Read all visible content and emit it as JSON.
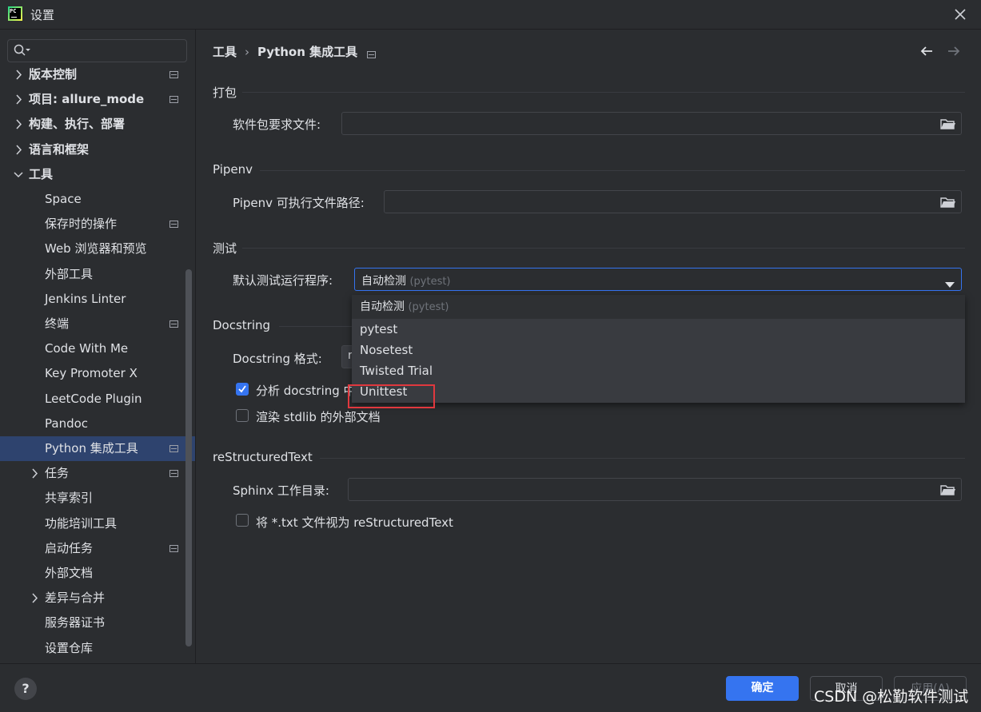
{
  "window": {
    "title": "设置",
    "logo_text": "PC"
  },
  "search": {
    "placeholder": ""
  },
  "sidebar": {
    "items": [
      {
        "label": "版本控制",
        "level": 0,
        "expand": "collapsed",
        "modified": true
      },
      {
        "label": "项目: allure_mode",
        "level": 0,
        "expand": "collapsed",
        "modified": true
      },
      {
        "label": "构建、执行、部署",
        "level": 0,
        "expand": "collapsed",
        "modified": false
      },
      {
        "label": "语言和框架",
        "level": 0,
        "expand": "collapsed",
        "modified": false
      },
      {
        "label": "工具",
        "level": 0,
        "expand": "expanded",
        "modified": false
      },
      {
        "label": "Space",
        "level": 1,
        "expand": "none",
        "modified": false
      },
      {
        "label": "保存时的操作",
        "level": 1,
        "expand": "none",
        "modified": true
      },
      {
        "label": "Web 浏览器和预览",
        "level": 1,
        "expand": "none",
        "modified": false
      },
      {
        "label": "外部工具",
        "level": 1,
        "expand": "none",
        "modified": false
      },
      {
        "label": "Jenkins Linter",
        "level": 1,
        "expand": "none",
        "modified": false
      },
      {
        "label": "终端",
        "level": 1,
        "expand": "none",
        "modified": true
      },
      {
        "label": "Code With Me",
        "level": 1,
        "expand": "none",
        "modified": false
      },
      {
        "label": "Key Promoter X",
        "level": 1,
        "expand": "none",
        "modified": false
      },
      {
        "label": "LeetCode Plugin",
        "level": 1,
        "expand": "none",
        "modified": false
      },
      {
        "label": "Pandoc",
        "level": 1,
        "expand": "none",
        "modified": false
      },
      {
        "label": "Python 集成工具",
        "level": 1,
        "expand": "none",
        "modified": true,
        "selected": true
      },
      {
        "label": "任务",
        "level": 1,
        "expand": "collapsed",
        "modified": true
      },
      {
        "label": "共享索引",
        "level": 1,
        "expand": "none",
        "modified": false
      },
      {
        "label": "功能培训工具",
        "level": 1,
        "expand": "none",
        "modified": false
      },
      {
        "label": "启动任务",
        "level": 1,
        "expand": "none",
        "modified": true
      },
      {
        "label": "外部文档",
        "level": 1,
        "expand": "none",
        "modified": false
      },
      {
        "label": "差异与合并",
        "level": 1,
        "expand": "collapsed",
        "modified": false
      },
      {
        "label": "服务器证书",
        "level": 1,
        "expand": "none",
        "modified": false
      },
      {
        "label": "设置仓库",
        "level": 1,
        "expand": "none",
        "modified": false
      }
    ]
  },
  "breadcrumb": {
    "parent": "工具",
    "separator": "›",
    "current": "Python 集成工具"
  },
  "sections": {
    "packaging": {
      "title": "打包",
      "requirements_label": "软件包要求文件:",
      "requirements_value": ""
    },
    "pipenv": {
      "title": "Pipenv",
      "path_label": "Pipenv 可执行文件路径:",
      "path_value": ""
    },
    "testing": {
      "title": "测试",
      "runner_label": "默认测试运行程序:",
      "runner_value": "自动检测",
      "runner_hint": "(pytest)"
    },
    "docstring": {
      "title": "Docstring",
      "format_label": "Docstring 格式:",
      "format_value": "r",
      "analyze_label": "分析 docstring 中",
      "analyze_checked": true,
      "render_label": "渲染 stdlib 的外部文档",
      "render_checked": false
    },
    "rest": {
      "title": "reStructuredText",
      "sphinx_label": "Sphinx 工作目录:",
      "sphinx_value": "",
      "treat_txt_label": "将 *.txt 文件视为 reStructuredText",
      "treat_txt_checked": false
    }
  },
  "dropdown": {
    "options": [
      {
        "label": "自动检测",
        "hint": "(pytest)"
      },
      {
        "label": "pytest"
      },
      {
        "label": "Nosetest"
      },
      {
        "label": "Twisted Trial"
      },
      {
        "label": "Unittest"
      }
    ],
    "highlighted_option": "Unittest"
  },
  "footer": {
    "help_label": "?",
    "ok_label": "确定",
    "cancel_label": "取消",
    "apply_label": "应用(A)",
    "watermark": "CSDN @松勤软件测试"
  },
  "colors": {
    "background": "#2b2d30",
    "selection": "#2e436e",
    "accent": "#3574f0",
    "annotation": "#e0383e"
  },
  "icons": [
    "pycharm-logo-icon",
    "close-icon",
    "search-icon",
    "chevron-right-icon",
    "chevron-down-icon",
    "modified-settings-icon",
    "back-arrow-icon",
    "forward-arrow-icon",
    "folder-icon",
    "dropdown-arrow-icon",
    "checkmark-icon",
    "help-icon"
  ]
}
